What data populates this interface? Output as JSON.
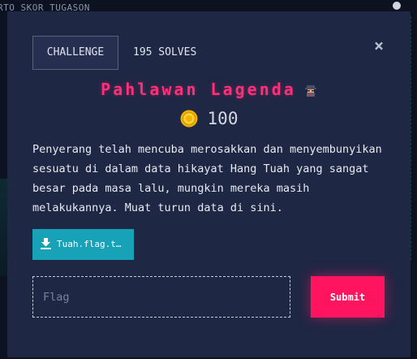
{
  "background": {
    "topbar_text": "RTO SKOR  TUGASON"
  },
  "modal": {
    "tabs": {
      "challenge_label": "CHALLENGE",
      "solves_label": "195 SOLVES"
    },
    "close_label": "×",
    "challenge": {
      "title": "Pahlawan Lagenda",
      "title_icon": "spy-detective-icon",
      "points_icon": "gold-coin-icon",
      "points": "100",
      "description": "Penyerang telah mencuba merosakkan dan menyembunyikan sesuatu di dalam data hikayat Hang Tuah yang sangat besar pada masa lalu, mungkin mereka masih melakukannya. Muat turun data di sini.",
      "file_label": "Tuah.flag.t…",
      "file_icon": "download-icon"
    },
    "flag_input": {
      "placeholder": "Flag",
      "value": ""
    },
    "submit_label": "Submit"
  },
  "colors": {
    "title": "#ff2f79",
    "submit": "#ff155f",
    "file_button": "#17a2b8",
    "modal_bg": "#1e2744"
  }
}
